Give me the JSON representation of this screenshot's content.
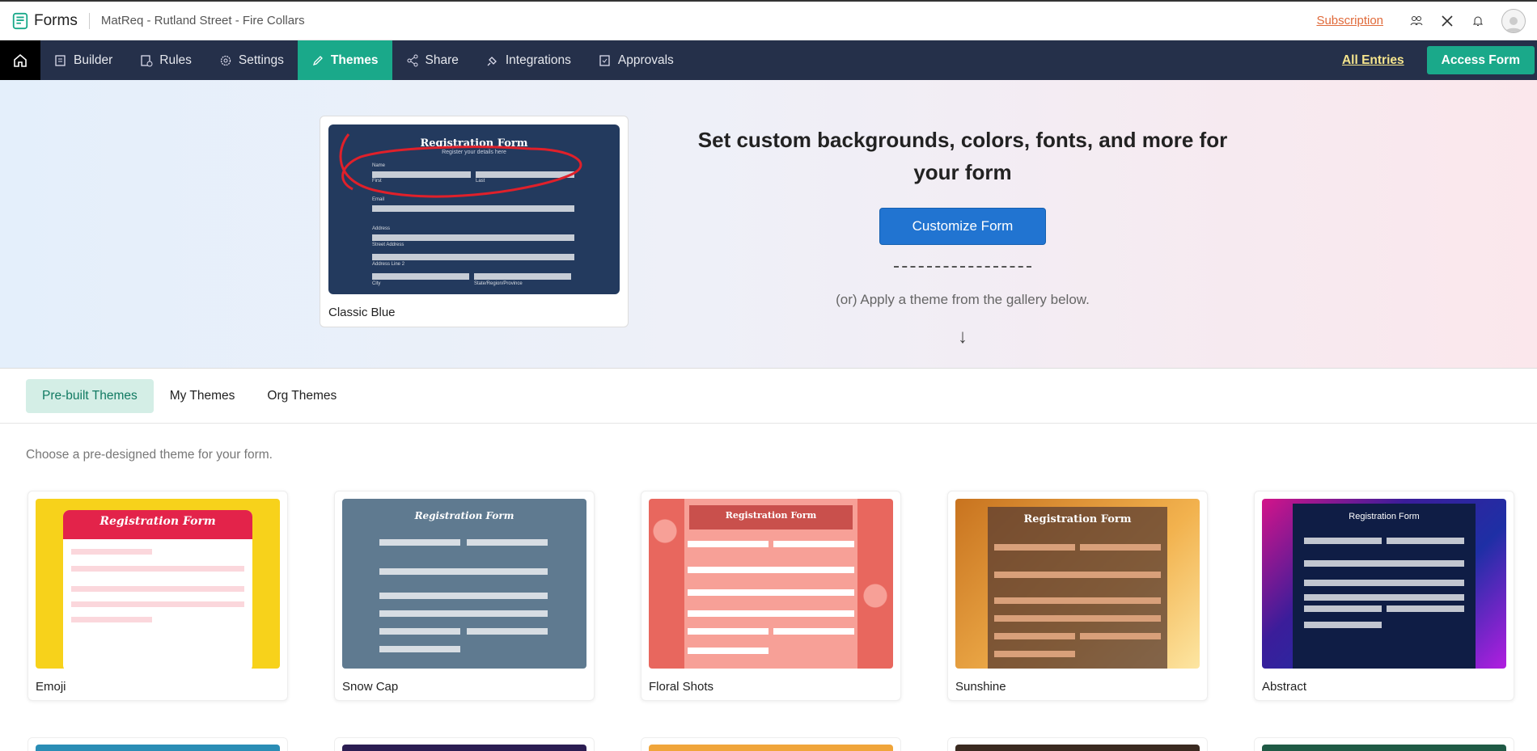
{
  "app": {
    "name": "Forms",
    "form_title": "MatReq - Rutland Street - Fire Collars",
    "subscription_label": "Subscription"
  },
  "nav": {
    "items": [
      {
        "label": "Builder",
        "icon": "builder-icon"
      },
      {
        "label": "Rules",
        "icon": "rules-icon"
      },
      {
        "label": "Settings",
        "icon": "gear-icon"
      },
      {
        "label": "Themes",
        "icon": "brush-icon",
        "active": true
      },
      {
        "label": "Share",
        "icon": "share-icon"
      },
      {
        "label": "Integrations",
        "icon": "plug-icon"
      },
      {
        "label": "Approvals",
        "icon": "approvals-icon"
      }
    ],
    "all_entries": "All Entries",
    "access_form": "Access Form"
  },
  "hero": {
    "current_theme": "Classic Blue",
    "preview_title": "Registration Form",
    "preview_subtitle": "Register your details here",
    "preview_labels": [
      "Name",
      "First",
      "Last",
      "Email",
      "Address",
      "Street Address",
      "Address Line 2",
      "City",
      "State/Region/Province"
    ],
    "heading": "Set custom backgrounds, colors, fonts, and more for your form",
    "customize_button": "Customize Form",
    "or_text": "(or) Apply a theme from the gallery below.",
    "arrow": "↓"
  },
  "tabs": [
    {
      "label": "Pre-built Themes",
      "active": true
    },
    {
      "label": "My Themes"
    },
    {
      "label": "Org Themes"
    }
  ],
  "gallery": {
    "description": "Choose a pre-designed theme for your form.",
    "themes": [
      {
        "name": "Emoji",
        "bg": "#f7d21b",
        "panel": "#ffffff",
        "header": "#e3234a"
      },
      {
        "name": "Snow Cap",
        "bg": "#5f7a90",
        "panel": "#5f7a90",
        "header": "#5f7a90"
      },
      {
        "name": "Floral Shots",
        "bg": "#e8675e",
        "panel": "#f7a097",
        "header": "#c9504c"
      },
      {
        "name": "Sunshine",
        "bg": "#d9882e",
        "panel": "#6b4b3a",
        "header": "#6b4b3a"
      },
      {
        "name": "Abstract",
        "bg": "#3b1d9a",
        "panel": "#0f1d45",
        "header": "#0f1d45"
      }
    ],
    "second_row_colors": [
      "#2a8db5",
      "#2b1d52",
      "#f0a53a",
      "#3a2a20",
      "#1f5a45"
    ]
  },
  "colors": {
    "nav_bg": "#25304a",
    "accent": "#1aa98a",
    "link": "#e06a3a",
    "primary_button": "#2174d1"
  }
}
